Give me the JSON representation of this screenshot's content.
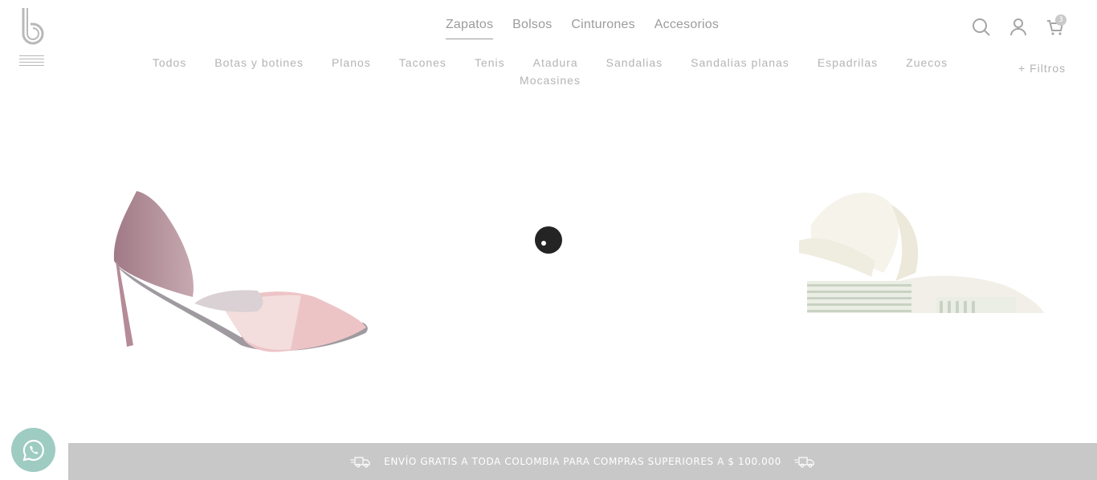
{
  "header": {
    "logo_icon": "brand-logo",
    "menu_icon": "hamburger-menu-icon",
    "nav": [
      {
        "label": "Zapatos",
        "active": true
      },
      {
        "label": "Bolsos",
        "active": false
      },
      {
        "label": "Cinturones",
        "active": false
      },
      {
        "label": "Accesorios",
        "active": false
      }
    ],
    "icons": {
      "search": "search-icon",
      "account": "user-icon",
      "cart": "cart-icon",
      "cart_count": "3"
    }
  },
  "subnav": {
    "items": [
      "Todos",
      "Botas y botines",
      "Planos",
      "Tacones",
      "Tenis",
      "Atadura",
      "Sandalias",
      "Sandalias planas",
      "Espadrilas",
      "Zuecos",
      "Mocasines"
    ],
    "filters_label": "+ Filtros"
  },
  "products": [
    {
      "image": "pointed-heel-shoe-image"
    },
    {
      "image": "espadrille-sandal-image"
    }
  ],
  "loader": {
    "icon": "loading-spinner"
  },
  "banner": {
    "text": "ENVÍO GRATIS A TODA COLOMBIA PARA COMPRAS SUPERIORES A $ 100.000",
    "icon": "delivery-truck-icon",
    "color": "#c8c8c8"
  },
  "whatsapp": {
    "icon": "whatsapp-icon",
    "color": "#9ecbc2"
  }
}
